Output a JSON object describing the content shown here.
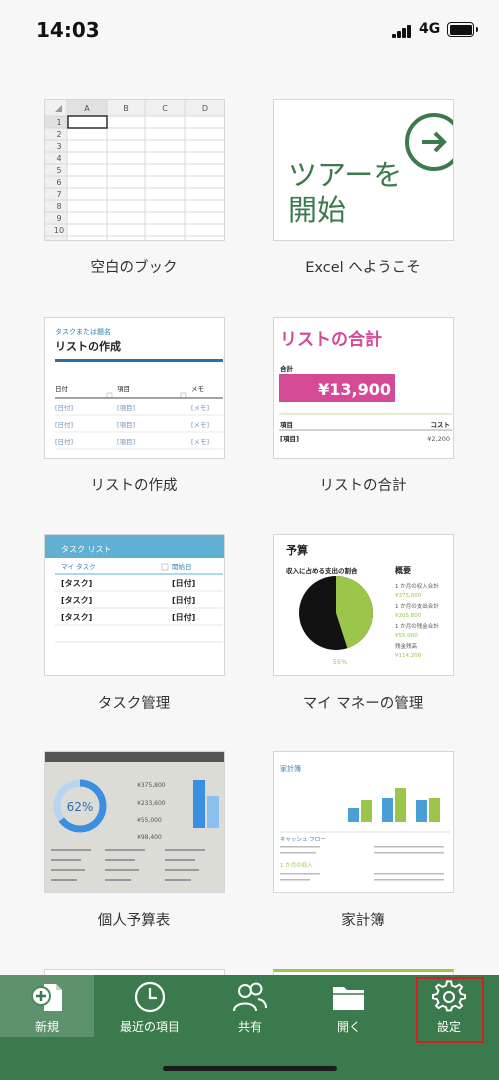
{
  "status_bar": {
    "time": "14:03",
    "network": "4G"
  },
  "templates": [
    {
      "label": "空白のブック"
    },
    {
      "label": "Excel へようこそ",
      "title": "ツアーを\n開始"
    },
    {
      "label": "リストの作成",
      "subtitle": "タスクまたは題名",
      "title": "リストの作成",
      "headers": [
        "日付",
        "項目",
        "メモ"
      ],
      "rows": [
        [
          "[日付]",
          "[項目]",
          "[メモ]"
        ],
        [
          "[日付]",
          "[項目]",
          "[メモ]"
        ],
        [
          "[日付]",
          "[項目]",
          "[メモ]"
        ]
      ]
    },
    {
      "label": "リストの合計",
      "title": "リストの合計",
      "total_label": "合計",
      "total": "¥13,900",
      "col_item": "項目",
      "col_cost": "コスト",
      "row_item": "[項目]",
      "row_cost": "¥2,200"
    },
    {
      "label": "タスク管理",
      "title": "タスク リスト",
      "col1": "マイ タスク",
      "col2": "開始日",
      "rows": [
        [
          "[タスク]",
          "[日付]"
        ],
        [
          "[タスク]",
          "[日付]"
        ],
        [
          "[タスク]",
          "[日付]"
        ]
      ]
    },
    {
      "label": "マイ マネーの管理",
      "title": "予算",
      "chart_title": "収入に占める支出の割合",
      "percent": "55%",
      "summary_title": "概要",
      "summary": [
        [
          "1 か月の収入合計",
          "¥375,000"
        ],
        [
          "1 か月の支出合計",
          "¥205,800"
        ],
        [
          "1 か月の残金合計",
          "¥55,000"
        ],
        [
          "残金残高",
          "¥114,200"
        ]
      ]
    },
    {
      "label": "個人予算表",
      "percent": "62%",
      "values": [
        "¥375,800",
        "¥233,600",
        "¥55,000",
        "¥98,400"
      ]
    },
    {
      "label": "家計簿",
      "title": "家計簿",
      "section1": "キャッシュ フロー",
      "section2": "1 か月の収入"
    }
  ],
  "grid": {
    "columns": [
      "A",
      "B",
      "C",
      "D"
    ],
    "rows": [
      "1",
      "2",
      "3",
      "4",
      "5",
      "6",
      "7",
      "8",
      "9",
      "10"
    ]
  },
  "bottom_nav": [
    {
      "label": "新規",
      "icon": "new-file-icon"
    },
    {
      "label": "最近の項目",
      "icon": "clock-icon"
    },
    {
      "label": "共有",
      "icon": "people-icon"
    },
    {
      "label": "開く",
      "icon": "folder-icon"
    },
    {
      "label": "設定",
      "icon": "gear-icon"
    }
  ],
  "colors": {
    "accent": "#3a7a4c",
    "pink": "#d54a94",
    "teal": "#2e7fb0",
    "green_light": "#9bc64b"
  }
}
